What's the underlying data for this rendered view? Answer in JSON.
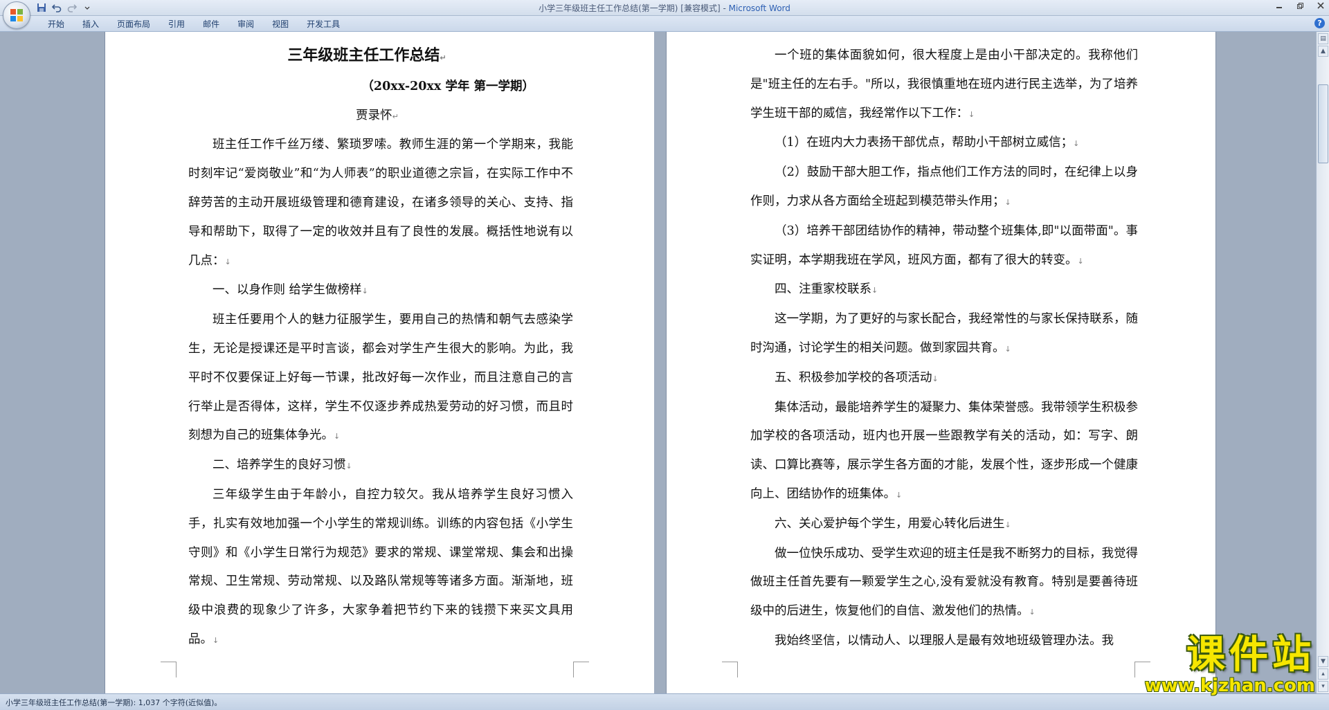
{
  "window": {
    "title_doc": "小学三年级班主任工作总结(第一学期) [兼容模式]",
    "title_sep": " - ",
    "title_app": "Microsoft Word"
  },
  "ribbon": {
    "tabs": [
      "开始",
      "插入",
      "页面布局",
      "引用",
      "邮件",
      "审阅",
      "视图",
      "开发工具"
    ]
  },
  "document": {
    "title": "三年级班主任工作总结",
    "subtitle": "（20xx-20xx 学年  第一学期）",
    "author": "贾录怀",
    "page1": [
      "班主任工作千丝万缕、繁琐罗嗦。教师生涯的第一个学期来，我能时刻牢记“爱岗敬业”和“为人师表”的职业道德之宗旨，在实际工作中不辞劳苦的主动开展班级管理和德育建设，在诸多领导的关心、支持、指导和帮助下，取得了一定的收效并且有了良性的发展。概括性地说有以几点：",
      "一、以身作则 给学生做榜样",
      "班主任要用个人的魅力征服学生，要用自己的热情和朝气去感染学生，无论是授课还是平时言谈，都会对学生产生很大的影响。为此，我平时不仅要保证上好每一节课，批改好每一次作业，而且注意自己的言行举止是否得体，这样，学生不仅逐步养成热爱劳动的好习惯，而且时刻想为自己的班集体争光。",
      "二、培养学生的良好习惯",
      "三年级学生由于年龄小，自控力较欠。我从培养学生良好习惯入手，扎实有效地加强一个小学生的常规训练。训练的内容包括《小学生守则》和《小学生日常行为规范》要求的常规、课堂常规、集会和出操常规、卫生常规、劳动常规、以及路队常规等等诸多方面。渐渐地，班级中浪费的现象少了许多，大家争着把节约下来的钱攒下来买文具用品。"
    ],
    "page2": [
      "一个班的集体面貌如何，很大程度上是由小干部决定的。我称他们是\"班主任的左右手。\"所以，我很慎重地在班内进行民主选举，为了培养学生班干部的威信，我经常作以下工作：",
      "（1）在班内大力表扬干部优点，帮助小干部树立威信；",
      "（2）鼓励干部大胆工作，指点他们工作方法的同时，在纪律上以身作则，力求从各方面给全班起到模范带头作用；",
      "（3）培养干部团结协作的精神，带动整个班集体,即\"以面带面\"。事实证明，本学期我班在学风，班风方面，都有了很大的转变。",
      "四、注重家校联系",
      "这一学期，为了更好的与家长配合，我经常性的与家长保持联系，随时沟通，讨论学生的相关问题。做到家园共育。",
      "五、积极参加学校的各项活动",
      "集体活动，最能培养学生的凝聚力、集体荣誉感。我带领学生积极参加学校的各项活动，班内也开展一些跟教学有关的活动，如：写字、朗读、口算比赛等，展示学生各方面的才能，发展个性，逐步形成一个健康向上、团结协作的班集体。",
      "六、关心爱护每个学生，用爱心转化后进生",
      "做一位快乐成功、受学生欢迎的班主任是我不断努力的目标，我觉得做班主任首先要有一颗爱学生之心,没有爱就没有教育。特别是要善待班级中的后进生，恢复他们的自信、激发他们的热情。",
      "我始终坚信，以情动人、以理服人是最有效地班级管理办法。我"
    ]
  },
  "status": {
    "text": "小学三年级班主任工作总结(第一学期): 1,037 个字符(近似值)。"
  },
  "watermark": {
    "title": "课件站",
    "url": "www.kjzhan.com"
  },
  "colors": {
    "title_app": "#2d5fb3",
    "watermark_fill": "#f6e600",
    "workspace": "#a0adbf"
  },
  "icons": {
    "save": "save-icon",
    "undo": "undo-icon",
    "redo": "redo-icon",
    "customize": "chevron-down-icon",
    "minimize": "minimize-icon",
    "restore": "restore-icon",
    "close": "close-icon",
    "help": "help-icon"
  }
}
